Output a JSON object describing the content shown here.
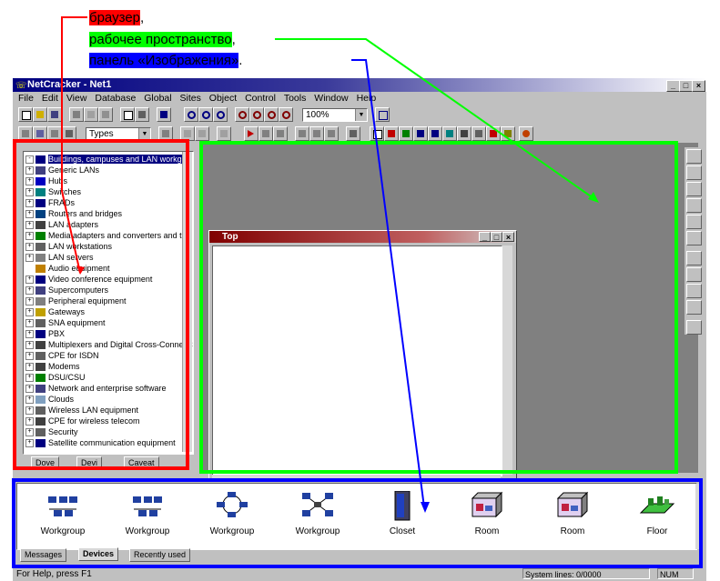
{
  "annotations": {
    "browser": {
      "label": "браузер",
      "suffix": ",",
      "color": "#ff0000"
    },
    "workspace": {
      "label": "рабочее пространство",
      "suffix": ",",
      "color": "#00ff00"
    },
    "images_panel": {
      "label": "панель «Изображения»",
      "suffix": ".",
      "color": "#0000ff"
    }
  },
  "window": {
    "title": "NetCracker - Net1",
    "min_glyph": "_",
    "max_glyph": "□",
    "close_glyph": "×"
  },
  "menu": [
    "File",
    "Edit",
    "View",
    "Database",
    "Global",
    "Sites",
    "Object",
    "Control",
    "Tools",
    "Window",
    "Help"
  ],
  "toolbar": {
    "zoom_value": "100%",
    "types_value": "Types",
    "dropdown_arrow": "▼"
  },
  "browser": {
    "items": [
      {
        "label": "Buildings, campuses and LAN workgr",
        "pm": "-",
        "selected": true
      },
      {
        "label": "Generic LANs",
        "pm": "+"
      },
      {
        "label": "Hubs",
        "pm": "+"
      },
      {
        "label": "Switches",
        "pm": "+"
      },
      {
        "label": "FRADs",
        "pm": "+"
      },
      {
        "label": "Routers and bridges",
        "pm": "+"
      },
      {
        "label": "LAN adapters",
        "pm": "+"
      },
      {
        "label": "Media adapters and converters and tra",
        "pm": "+"
      },
      {
        "label": "LAN workstations",
        "pm": "+"
      },
      {
        "label": "LAN servers",
        "pm": "+"
      },
      {
        "label": "Audio equipment",
        "pm": ""
      },
      {
        "label": "Video conference equipment",
        "pm": "+"
      },
      {
        "label": "Supercomputers",
        "pm": "+"
      },
      {
        "label": "Peripheral equipment",
        "pm": "+"
      },
      {
        "label": "Gateways",
        "pm": "+"
      },
      {
        "label": "SNA equipment",
        "pm": "+"
      },
      {
        "label": "PBX",
        "pm": "+"
      },
      {
        "label": "Multiplexers and Digital Cross-Connect S",
        "pm": "+"
      },
      {
        "label": "CPE for ISDN",
        "pm": "+"
      },
      {
        "label": "Modems",
        "pm": "+"
      },
      {
        "label": "DSU/CSU",
        "pm": "+"
      },
      {
        "label": "Network and enterprise software",
        "pm": "+"
      },
      {
        "label": "Clouds",
        "pm": "+"
      },
      {
        "label": "Wireless LAN equipment",
        "pm": "+"
      },
      {
        "label": "CPE for wireless telecom",
        "pm": "+"
      },
      {
        "label": "Security",
        "pm": "+"
      },
      {
        "label": "Satellite communication equipment",
        "pm": "+"
      }
    ],
    "tabs": [
      "Dove",
      "Devi",
      "Caveat"
    ]
  },
  "child_window": {
    "title": "Top",
    "min_glyph": "_",
    "max_glyph": "□",
    "close_glyph": "×"
  },
  "devices": {
    "items": [
      {
        "label": "Workgroup",
        "icon": "workgroup-icon"
      },
      {
        "label": "Workgroup",
        "icon": "workgroup-icon"
      },
      {
        "label": "Workgroup",
        "icon": "workgroup-ring-icon"
      },
      {
        "label": "Workgroup",
        "icon": "workgroup-star-icon"
      },
      {
        "label": "Closet",
        "icon": "closet-icon"
      },
      {
        "label": "Room",
        "icon": "room-icon"
      },
      {
        "label": "Room",
        "icon": "room-icon"
      },
      {
        "label": "Floor",
        "icon": "floor-icon"
      }
    ],
    "tabs": [
      "Messages",
      "Devices",
      "Recently used"
    ]
  },
  "status": {
    "help": "For Help, press F1",
    "lines": "System lines: 0/0000",
    "num": "NUM"
  }
}
